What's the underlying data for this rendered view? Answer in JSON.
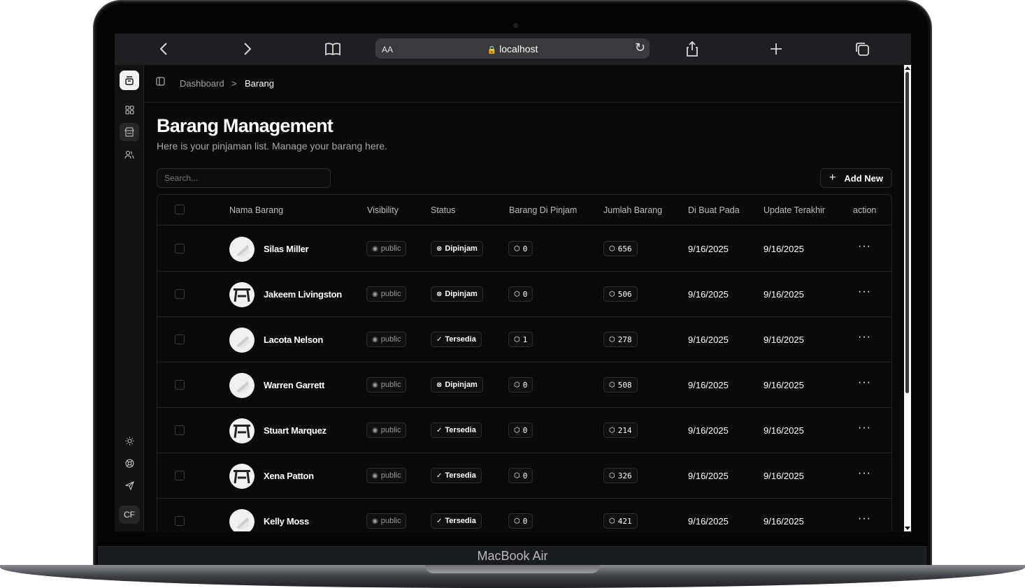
{
  "device": {
    "model": "MacBook Air"
  },
  "browser": {
    "url": "localhost",
    "aa": "AA"
  },
  "sidebar": {
    "user_initials": "CF"
  },
  "breadcrumb": {
    "root": "Dashboard",
    "separator": ">",
    "current": "Barang"
  },
  "page": {
    "title": "Barang Management",
    "subtitle": "Here is your pinjaman list. Manage your barang here."
  },
  "search": {
    "placeholder": "Search..."
  },
  "add_button": {
    "icon": "+",
    "label": "Add New"
  },
  "table": {
    "headers": {
      "name": "Nama Barang",
      "visibility": "Visibility",
      "status": "Status",
      "borrowed": "Barang Di Pinjam",
      "quantity": "Jumlah Barang",
      "created": "Di Buat Pada",
      "updated": "Update Terakhir",
      "action": "action"
    },
    "rows": [
      {
        "name": "Silas Miller",
        "visibility": "public",
        "status": "Dipinjam",
        "borrowed": "0",
        "quantity": "656",
        "created": "9/16/2025",
        "updated": "9/16/2025",
        "action": "···"
      },
      {
        "name": "Jakeem Livingston",
        "visibility": "public",
        "status": "Dipinjam",
        "borrowed": "0",
        "quantity": "506",
        "created": "9/16/2025",
        "updated": "9/16/2025",
        "action": "···"
      },
      {
        "name": "Lacota Nelson",
        "visibility": "public",
        "status": "Tersedia",
        "borrowed": "1",
        "quantity": "278",
        "created": "9/16/2025",
        "updated": "9/16/2025",
        "action": "···"
      },
      {
        "name": "Warren Garrett",
        "visibility": "public",
        "status": "Dipinjam",
        "borrowed": "0",
        "quantity": "508",
        "created": "9/16/2025",
        "updated": "9/16/2025",
        "action": "···"
      },
      {
        "name": "Stuart Marquez",
        "visibility": "public",
        "status": "Tersedia",
        "borrowed": "0",
        "quantity": "214",
        "created": "9/16/2025",
        "updated": "9/16/2025",
        "action": "···"
      },
      {
        "name": "Xena Patton",
        "visibility": "public",
        "status": "Tersedia",
        "borrowed": "0",
        "quantity": "326",
        "created": "9/16/2025",
        "updated": "9/16/2025",
        "action": "···"
      },
      {
        "name": "Kelly Moss",
        "visibility": "public",
        "status": "Tersedia",
        "borrowed": "0",
        "quantity": "421",
        "created": "9/16/2025",
        "updated": "9/16/2025",
        "action": "···"
      }
    ]
  },
  "colors": {
    "background": "#0a0a0a",
    "border": "#242424",
    "text": "#ffffff",
    "muted": "#a7a7a7"
  }
}
